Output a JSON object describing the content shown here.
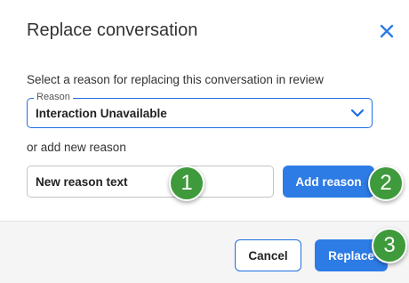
{
  "dialog": {
    "title": "Replace conversation",
    "close_icon": "close-icon"
  },
  "form": {
    "instruction": "Select a reason for replacing this conversation in review",
    "reason_select": {
      "legend": "Reason",
      "value": "Interaction Unavailable",
      "icon": "chevron-down-icon"
    },
    "or_label": "or add new reason",
    "new_reason_input": {
      "value": "New reason text"
    },
    "add_reason_label": "Add reason"
  },
  "footer": {
    "cancel_label": "Cancel",
    "replace_label": "Replace"
  },
  "markers": [
    "1",
    "2",
    "3"
  ],
  "colors": {
    "accent": "#2d7be5",
    "marker": "#3f9a3c"
  }
}
